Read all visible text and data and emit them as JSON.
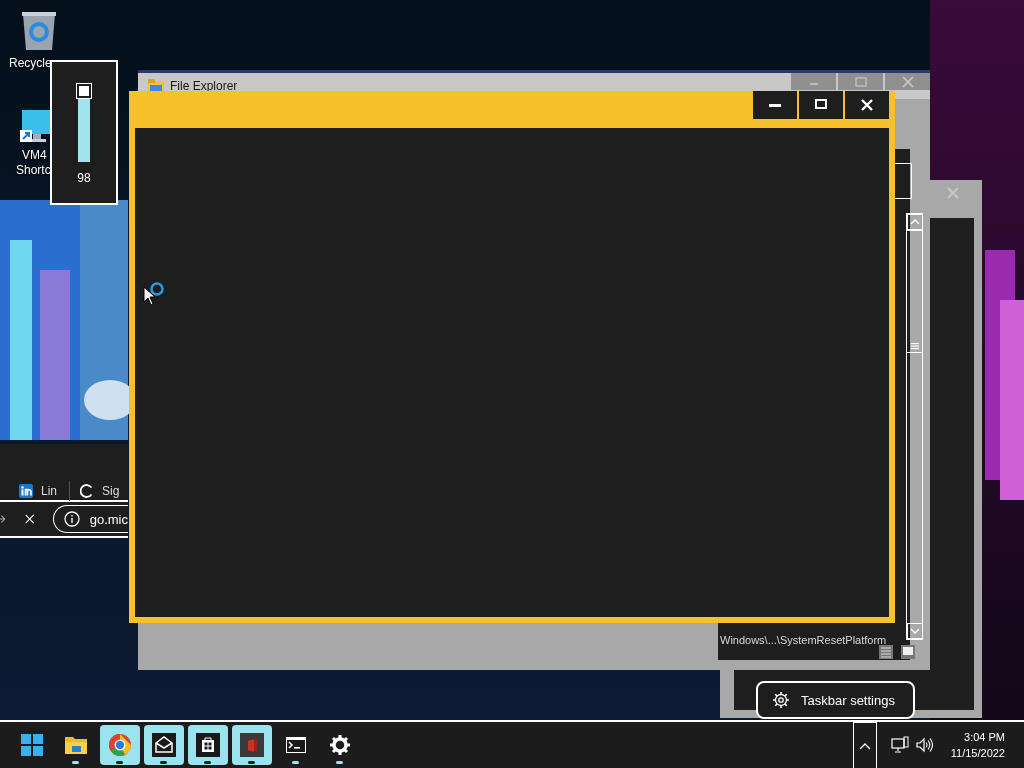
{
  "desktop_icons": [
    {
      "kind": "recycle-bin",
      "lines": [
        "Recycle"
      ]
    },
    {
      "kind": "monitor-shortcut",
      "lines": [
        "VM4",
        "Shortc"
      ]
    }
  ],
  "volume_flyout": {
    "level": 0.98,
    "reading": "98"
  },
  "explorer_window": {
    "title": "File Explorer",
    "status_text": "Windows\\...\\SystemResetPlatform"
  },
  "browser_window": {
    "tabs": [
      {
        "kind": "linkedin",
        "label": "Lin"
      },
      {
        "kind": "loading",
        "label": "Sig"
      }
    ],
    "address": "go.mic"
  },
  "active_window": {
    "buttons": [
      {
        "kind": "minimize"
      },
      {
        "kind": "maximize"
      },
      {
        "kind": "close"
      }
    ]
  },
  "context_menu": {
    "items": [
      {
        "kind": "settings",
        "label": "Taskbar settings"
      }
    ]
  },
  "taskbar": {
    "apps": [
      {
        "kind": "start",
        "highlighted": false,
        "running": false
      },
      {
        "kind": "folder",
        "highlighted": false,
        "running": true
      },
      {
        "kind": "browser",
        "highlighted": true,
        "running": true
      },
      {
        "kind": "mail",
        "highlighted": true,
        "running": true
      },
      {
        "kind": "store",
        "highlighted": true,
        "running": true
      },
      {
        "kind": "office",
        "highlighted": true,
        "running": true
      },
      {
        "kind": "terminal",
        "highlighted": false,
        "running": true
      },
      {
        "kind": "settings",
        "highlighted": false,
        "running": true
      }
    ],
    "time": "3:04 PM",
    "date": "11/15/2022"
  }
}
